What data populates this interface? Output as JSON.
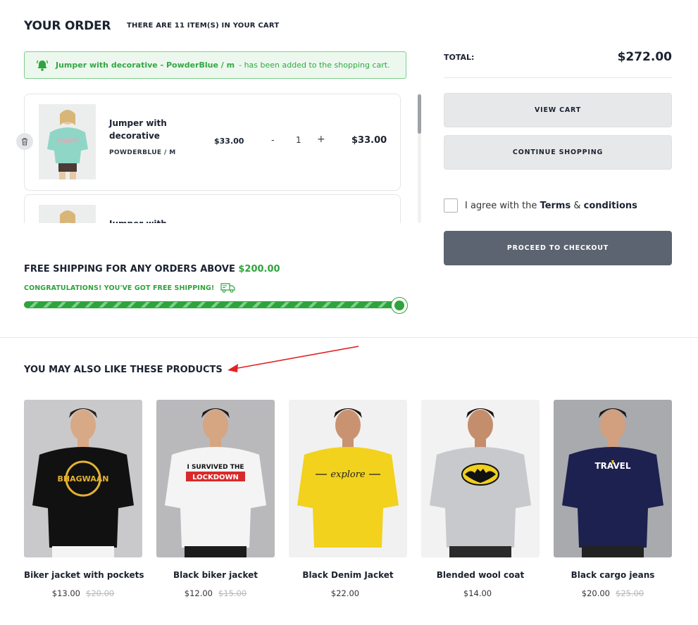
{
  "header": {
    "title": "YOUR ORDER",
    "count_text": "THERE ARE 11 ITEM(S) IN YOUR CART"
  },
  "notice": {
    "product": "Jumper with decorative - PowderBlue / m",
    "message": "- has been added to the shopping cart.",
    "icon": "bell-icon"
  },
  "cart": {
    "items": [
      {
        "name": "Jumper with decorative",
        "variant": "POWDERBLUE / M",
        "price": "$33.00",
        "quantity": "1",
        "minus": "-",
        "plus": "+",
        "subtotal": "$33.00"
      },
      {
        "name": "Jumper with",
        "variant": "",
        "price": "",
        "quantity": "",
        "minus": "",
        "plus": "",
        "subtotal": ""
      }
    ]
  },
  "shipping": {
    "heading": "FREE SHIPPING FOR ANY ORDERS ABOVE",
    "threshold": "$200.00",
    "congrats": "CONGRATULATIONS! YOU'VE GOT FREE SHIPPING!",
    "progress": 1.0
  },
  "summary": {
    "total_label": "TOTAL:",
    "total_value": "$272.00",
    "view_cart": "VIEW CART",
    "continue": "CONTINUE SHOPPING",
    "agree_prefix": "I agree with the",
    "terms": "Terms",
    "amp": "&",
    "conditions": "conditions",
    "checkout": "PROCEED TO CHECKOUT"
  },
  "related": {
    "heading": "YOU MAY ALSO LIKE THESE PRODUCTS",
    "products": [
      {
        "name": "Biker jacket with pockets",
        "price": "$13.00",
        "old_price": "$20.00",
        "shirt": "#111111",
        "bg": "#c9c9cb",
        "graphic": "BHAGWAAN"
      },
      {
        "name": "Black biker jacket",
        "price": "$12.00",
        "old_price": "$15.00",
        "shirt": "#f4f4f4",
        "bg": "#b9b9bc",
        "graphic": "I SURVIVED THE LOCKDOWN"
      },
      {
        "name": "Black Denim Jacket",
        "price": "$22.00",
        "old_price": "",
        "shirt": "#f2d21c",
        "bg": "#f1f1f1",
        "graphic": "explore"
      },
      {
        "name": "Blended wool coat",
        "price": "$14.00",
        "old_price": "",
        "shirt": "#c7c9cd",
        "bg": "#f2f2f2",
        "graphic": ""
      },
      {
        "name": "Black cargo jeans",
        "price": "$20.00",
        "old_price": "$25.00",
        "shirt": "#1d2150",
        "bg": "#a9aaad",
        "graphic": "TRAVEL"
      }
    ]
  },
  "colors": {
    "accent_green": "#2ea43c",
    "checkout_bg": "#5b6470",
    "annotation_arrow": "#e02424"
  }
}
